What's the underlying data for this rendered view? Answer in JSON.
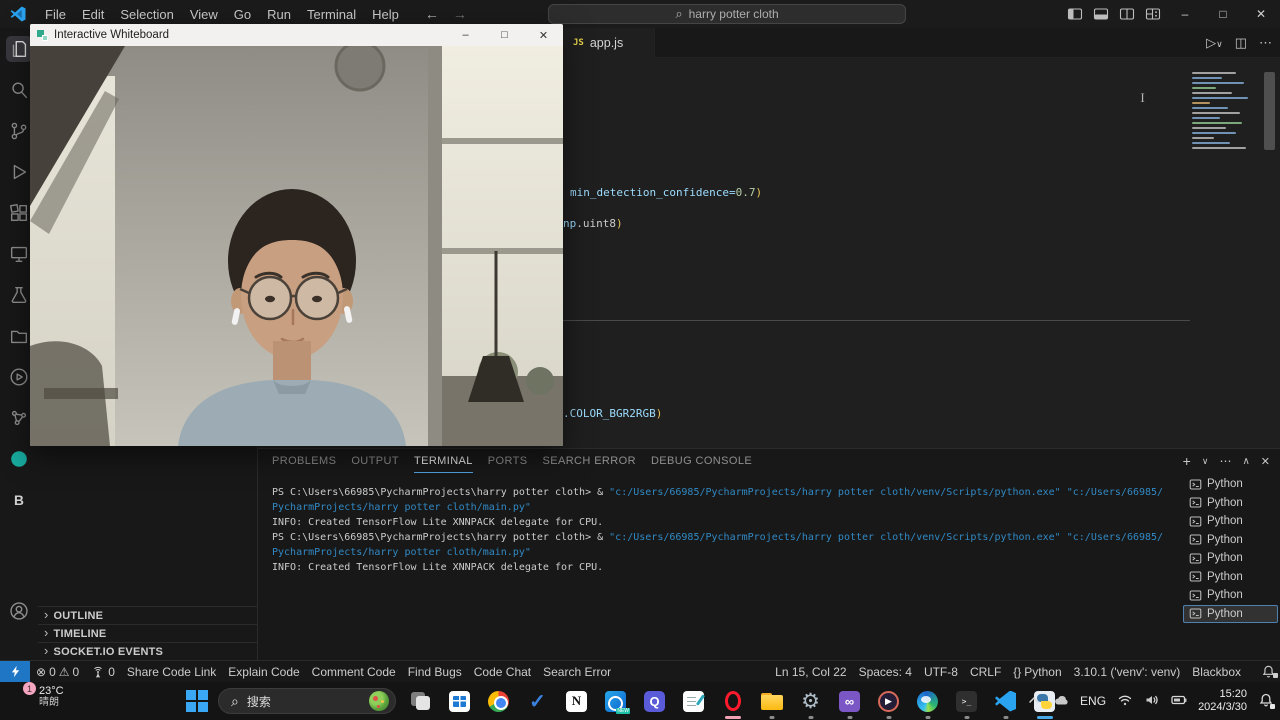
{
  "colors": {
    "accent_blue": "#1f76c4",
    "terminal_path_blue": "#3189c4",
    "code_blue": "#9cdcfe",
    "code_number_green": "#b5cea8",
    "code_paren_gold": "#e9c55c",
    "opera_active_pink": "#f2a0b4",
    "python_active_blue": "#48a8e8"
  },
  "icons": {
    "search_glyph": "⌕",
    "back": "←",
    "forward": "→",
    "minimize": "–",
    "maximize": "□",
    "close": "✕",
    "run": "▷",
    "run_dropdown": "∨",
    "split_editor": "◫",
    "more": "⋯",
    "new_terminal": "+",
    "dropdown": "∨",
    "panel_max": "∧",
    "section_chevron": "›",
    "error": "⊗",
    "warning": "⚠",
    "braces": "{}",
    "ibeam": "I",
    "terminal_prompt": ">_",
    "play": "▶",
    "infinity": "∞",
    "gear": "⚙",
    "check": "✓"
  },
  "menubar": {
    "items": [
      "File",
      "Edit",
      "Selection",
      "View",
      "Go",
      "Run",
      "Terminal",
      "Help"
    ]
  },
  "command_center": {
    "search_value": "harry potter cloth"
  },
  "whiteboard": {
    "title": "Interactive Whiteboard"
  },
  "activitybar": {
    "items": [
      {
        "name": "explorer",
        "active": true
      },
      {
        "name": "search"
      },
      {
        "name": "source-control"
      },
      {
        "name": "run-and-debug"
      },
      {
        "name": "extensions"
      },
      {
        "name": "remote-explorer"
      },
      {
        "name": "testing"
      },
      {
        "name": "library"
      },
      {
        "name": "live-preview"
      },
      {
        "name": "dependencies"
      },
      {
        "name": "teal-extension"
      },
      {
        "name": "blackbox"
      }
    ],
    "bottom": [
      {
        "name": "account"
      }
    ]
  },
  "sidebar": {
    "sections": [
      "OUTLINE",
      "TIMELINE",
      "SOCKET.IO EVENTS"
    ]
  },
  "editor": {
    "tab": {
      "label": "app.js",
      "icon_label": "JS"
    },
    "code_lines": [
      {
        "segments": [
          {
            "t": "min_detection_confidence=",
            "c": "#9cdcfe"
          },
          {
            "t": "0.7",
            "c": "#b5cea8"
          },
          {
            "t": ")",
            "c": "#e9c55c"
          }
        ]
      },
      {
        "segments": [
          {
            "t": "np",
            "c": "#9cdcfe"
          },
          {
            "t": ".uint8",
            "c": "#cccccc"
          },
          {
            "t": ")",
            "c": "#e9c55c"
          }
        ]
      },
      {
        "segments": [
          {
            "t": ".COLOR_BGR2RGB",
            "c": "#9cdcfe"
          },
          {
            "t": ")",
            "c": "#e9c55c"
          }
        ]
      }
    ]
  },
  "panel": {
    "tabs": [
      {
        "label": "PROBLEMS"
      },
      {
        "label": "OUTPUT"
      },
      {
        "label": "TERMINAL",
        "active": true
      },
      {
        "label": "PORTS"
      },
      {
        "label": "SEARCH ERROR"
      },
      {
        "label": "DEBUG CONSOLE"
      }
    ],
    "terminal_lines": [
      {
        "segments": [
          {
            "t": "PS C:\\Users\\66985\\PycharmProjects\\harry potter cloth> & ",
            "c": "#cccccc"
          },
          {
            "t": "\"c:/Users/66985/PycharmProjects/harry potter cloth/venv/Scripts/python.exe\"",
            "c": "#3189c4"
          },
          {
            "t": " ",
            "c": "#cccccc"
          },
          {
            "t": "\"c:/Users/66985/",
            "c": "#3189c4"
          }
        ]
      },
      {
        "segments": [
          {
            "t": "PycharmProjects/harry potter cloth/main.py\"",
            "c": "#3189c4"
          }
        ]
      },
      {
        "segments": [
          {
            "t": "INFO: Created TensorFlow Lite XNNPACK delegate for CPU.",
            "c": "#cccccc"
          }
        ]
      },
      {
        "segments": [
          {
            "t": "PS C:\\Users\\66985\\PycharmProjects\\harry potter cloth> & ",
            "c": "#cccccc"
          },
          {
            "t": "\"c:/Users/66985/PycharmProjects/harry potter cloth/venv/Scripts/python.exe\"",
            "c": "#3189c4"
          },
          {
            "t": " ",
            "c": "#cccccc"
          },
          {
            "t": "\"c:/Users/66985/",
            "c": "#3189c4"
          }
        ]
      },
      {
        "segments": [
          {
            "t": "PycharmProjects/harry potter cloth/main.py\"",
            "c": "#3189c4"
          }
        ]
      },
      {
        "segments": [
          {
            "t": "INFO: Created TensorFlow Lite XNNPACK delegate for CPU.",
            "c": "#cccccc"
          }
        ]
      }
    ],
    "processes": {
      "items": [
        "Python",
        "Python",
        "Python",
        "Python",
        "Python",
        "Python",
        "Python",
        "Python"
      ],
      "selected_index": 7
    }
  },
  "statusbar": {
    "errors": "0",
    "warnings": "0",
    "ports": "0",
    "actions": [
      "Share Code Link",
      "Explain Code",
      "Comment Code",
      "Find Bugs",
      "Code Chat",
      "Search Error"
    ],
    "right": [
      {
        "name": "cursor-position",
        "label": "Ln 15, Col 22"
      },
      {
        "name": "indentation",
        "label": "Spaces: 4"
      },
      {
        "name": "encoding",
        "label": "UTF-8"
      },
      {
        "name": "eol",
        "label": "CRLF"
      },
      {
        "name": "language",
        "label": "Python",
        "icon": "braces"
      },
      {
        "name": "python-interpreter",
        "label": "3.10.1 ('venv': venv)"
      },
      {
        "name": "blackbox",
        "label": "Blackbox"
      }
    ]
  },
  "taskbar": {
    "weather": {
      "badge": "1",
      "temp": "23°C",
      "condition": "晴朗"
    },
    "search_placeholder": "搜索",
    "outlook_badge": "NEW",
    "apps": [
      {
        "name": "task-view",
        "indicator": "none"
      },
      {
        "name": "microsoft-store",
        "indicator": "none"
      },
      {
        "name": "chrome",
        "indicator": "none"
      },
      {
        "name": "microsoft-todo",
        "indicator": "none"
      },
      {
        "name": "notion",
        "indicator": "none"
      },
      {
        "name": "outlook",
        "indicator": "none"
      },
      {
        "name": "quark",
        "indicator": "none"
      },
      {
        "name": "notes",
        "indicator": "none"
      },
      {
        "name": "opera",
        "indicator": "active",
        "indicator_color": "#f2a0b4"
      },
      {
        "name": "file-explorer",
        "indicator": "dot"
      },
      {
        "name": "settings",
        "indicator": "dot"
      },
      {
        "name": "visual-studio",
        "indicator": "dot"
      },
      {
        "name": "media-player",
        "indicator": "dot"
      },
      {
        "name": "edge",
        "indicator": "dot"
      },
      {
        "name": "terminal",
        "indicator": "dot"
      },
      {
        "name": "vscode",
        "indicator": "dot"
      },
      {
        "name": "python-app",
        "indicator": "active",
        "indicator_color": "#48a8e8"
      }
    ],
    "tray": {
      "language": "ENG",
      "time": "15:20",
      "date": "2024/3/30"
    }
  }
}
